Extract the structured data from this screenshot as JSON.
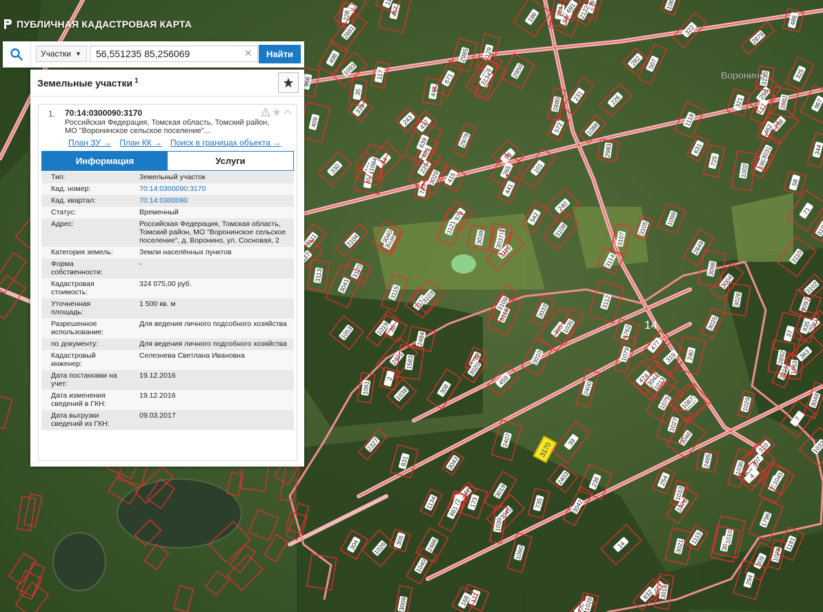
{
  "app": {
    "title": "ПУБЛИЧНАЯ КАДАСТРОВАЯ КАРТА"
  },
  "search": {
    "type_label": "Участки",
    "query": "56,551235 85,256069",
    "button_label": "Найти"
  },
  "panel": {
    "title": "Земельные участки",
    "count": "1",
    "item": {
      "index": "1.",
      "cad_number": "70:14:0300090:3170",
      "address_short": "Российская Федерация, Томская область, Томский район, МО \"Воронинское сельское поселение\"...",
      "links": [
        "План ЗУ →",
        "План КК →",
        "Поиск в границах объекта →"
      ],
      "tabs": [
        "Информация",
        "Услуги"
      ],
      "rows": [
        {
          "key": "Тип:",
          "value": "Земельный участок"
        },
        {
          "key": "Кад. номер:",
          "value": "70:14:0300090:3170"
        },
        {
          "key": "Кад. квартал:",
          "value": "70:14:0300090"
        },
        {
          "key": "Статус:",
          "value": "Временный"
        },
        {
          "key": "Адрес:",
          "value": "Российская Федерация, Томская область, Томский район, МО \"Воронинское сельское поселение\", д. Воронино, ул. Сосновая, 2"
        },
        {
          "key": "Категория земель:",
          "value": "Земли населённых пунктов"
        },
        {
          "key": "Форма собственности:",
          "value": "-"
        },
        {
          "key": "Кадастровая стоимость:",
          "value": "324 075,00 руб."
        },
        {
          "key": "Уточненная площадь:",
          "value": "1 500 кв. м"
        },
        {
          "key": "Разрешенное использование:",
          "value": "Для ведения личного подсобного хозяйства"
        },
        {
          "key": "по документу:",
          "value": "Для ведения личного подсобного хозяйства"
        },
        {
          "key": "Кадастровый инженер:",
          "value": "Селезнева Светлана Ивановна"
        },
        {
          "key": "Дата постановки на учет:",
          "value": "19.12.2016"
        },
        {
          "key": "Дата изменения сведений в ГКН:",
          "value": "19.12.2016"
        },
        {
          "key": "Дата выгрузки сведений из ГКН:",
          "value": "09.03.2017"
        }
      ]
    }
  },
  "map": {
    "place_name": "Воронино",
    "quarter_label": "14",
    "highlighted_parcel": "3170",
    "parcel_labels": [
      "572",
      "503",
      "415",
      "426",
      "457",
      "542",
      "507",
      "437",
      "781",
      "17",
      "631",
      "76",
      "325",
      "321",
      "322",
      "71",
      "279",
      "98",
      "966",
      "967",
      "45",
      "44",
      "745",
      "409",
      "744",
      "129",
      "113",
      "339",
      "101",
      "282",
      "228",
      "226",
      "231",
      "240",
      "256",
      "238",
      "186",
      "265",
      "199",
      "344",
      "243",
      "691",
      "220",
      "441",
      "462",
      "448",
      "330",
      "35",
      "1021",
      "671",
      "639",
      "58",
      "1084",
      "726",
      "725",
      "1099",
      "1088",
      "1118",
      "2881",
      "2882",
      "3130",
      "3134",
      "2122",
      "2985",
      "2983",
      "2880",
      "1093",
      "2879",
      "1002",
      "2979",
      "978",
      "1062",
      "498",
      "486",
      "117",
      "2950",
      "3031",
      "3029",
      "3033",
      "3119",
      "3120",
      "3121",
      "3113",
      "3098",
      "3097",
      "3118",
      "3109",
      "3114",
      "3101",
      "3102",
      "3103",
      "3104",
      "3105",
      "3106",
      "3107",
      "3108",
      "3110",
      "3111",
      "3112",
      "3115",
      "3116",
      "3117",
      "2849",
      "3004",
      "3026",
      "3025",
      "3037",
      "3038",
      "3039",
      "3040",
      "3041",
      "3042",
      "3043",
      "3044",
      "3045",
      "3046",
      "3047",
      "3048",
      "237",
      "2401",
      "2403",
      "1583",
      "1134",
      "2337",
      "2789",
      "2241",
      "2407",
      "3009",
      "3010",
      "3015",
      "3016",
      "3017",
      "3018",
      "3019",
      "3020",
      "3021",
      "3022",
      "1040",
      "1026",
      "735",
      "39",
      "37",
      "38",
      "171",
      "173",
      "304",
      "254",
      "72",
      "168",
      "1087",
      "2892",
      "1796",
      "2400",
      "459",
      "835",
      "831",
      "832",
      "1762",
      "319",
      "310",
      "309",
      "308",
      "305",
      "307",
      "294",
      "476",
      "477",
      "474",
      "1061",
      "1039",
      "1013",
      "1045",
      "1032",
      "1053",
      "1019",
      "1027",
      "1010",
      "1115",
      "236",
      "2327",
      "1078",
      "1079",
      "1063",
      "1075",
      "363",
      "365",
      "1038",
      "1076",
      "240",
      "1090",
      "1181",
      "1036",
      "1035",
      "1033",
      "1029",
      "1028",
      "2",
      "4",
      "14",
      "861",
      "7",
      "2485",
      "2484",
      "2486"
    ]
  }
}
